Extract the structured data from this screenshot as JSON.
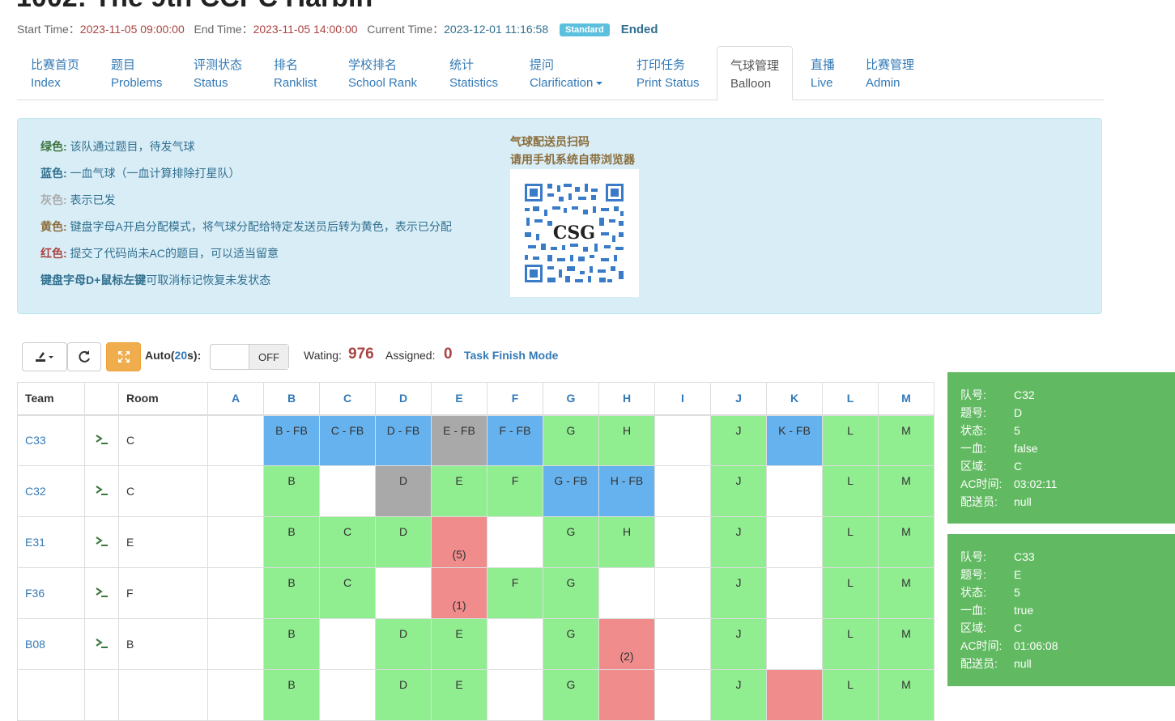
{
  "header": {
    "title": "1002: The 9th CCPC Harbin",
    "start_label": "Start Time：",
    "start_value": "2023-11-05 09:00:00",
    "end_label": "End Time：",
    "end_value": "2023-11-05 14:00:00",
    "current_label": "Current Time：",
    "current_value": "2023-12-01 11:16:58",
    "badge": "Standard",
    "status": "Ended"
  },
  "nav": [
    {
      "cn": "比赛首页",
      "en": "Index"
    },
    {
      "cn": "题目",
      "en": "Problems"
    },
    {
      "cn": "评测状态",
      "en": "Status"
    },
    {
      "cn": "排名",
      "en": "Ranklist"
    },
    {
      "cn": "学校排名",
      "en": "School Rank"
    },
    {
      "cn": "统计",
      "en": "Statistics"
    },
    {
      "cn": "提问",
      "en": "Clarification"
    },
    {
      "cn": "打印任务",
      "en": "Print Status"
    },
    {
      "cn": "气球管理",
      "en": "Balloon"
    },
    {
      "cn": "直播",
      "en": "Live"
    },
    {
      "cn": "比赛管理",
      "en": "Admin"
    }
  ],
  "legend": [
    {
      "key": "绿色:",
      "text": " 该队通过题目，待发气球",
      "color": "#3c763d"
    },
    {
      "key": "蓝色:",
      "text": " 一血气球（一血计算排除打星队）",
      "color": "#31708f"
    },
    {
      "key": "灰色:",
      "text": " 表示已发",
      "color": "#999999"
    },
    {
      "key": "黄色:",
      "text": " 键盘字母A开启分配模式，将气球分配给特定发送员后转为黄色，表示已分配",
      "color": "#8a6d3b"
    },
    {
      "key": "红色:",
      "text": " 提交了代码尚未AC的题目，可以适当留意",
      "color": "#a94442"
    },
    {
      "key": "键盘字母D+鼠标左键",
      "text": "可取消标记恢复未发状态",
      "color": "#31708f"
    }
  ],
  "qr": {
    "line1": "气球配送员扫码",
    "line2": "请用手机系统自带浏览器",
    "center_text": "CSG"
  },
  "toolbar": {
    "auto_label": "Auto(",
    "auto_num": "20",
    "auto_unit": "s):",
    "toggle_state": "OFF",
    "waiting_label": "Wating:",
    "waiting_value": "976",
    "assigned_label": "Assigned:",
    "assigned_value": "0",
    "mode_link": "Task Finish Mode"
  },
  "table": {
    "headers": [
      "Team",
      "",
      "Room",
      "A",
      "B",
      "C",
      "D",
      "E",
      "F",
      "G",
      "H",
      "I",
      "J",
      "K",
      "L",
      "M"
    ],
    "rows": [
      {
        "team": "C33",
        "room": "C",
        "cells": [
          null,
          {
            "t": "B - FB",
            "s": "blue"
          },
          {
            "t": "C - FB",
            "s": "blue"
          },
          {
            "t": "D - FB",
            "s": "blue"
          },
          {
            "t": "E - FB",
            "s": "gray"
          },
          {
            "t": "F - FB",
            "s": "blue"
          },
          {
            "t": "G",
            "s": "green"
          },
          {
            "t": "H",
            "s": "green"
          },
          null,
          {
            "t": "J",
            "s": "green"
          },
          {
            "t": "K - FB",
            "s": "blue"
          },
          {
            "t": "L",
            "s": "green"
          },
          {
            "t": "M",
            "s": "green"
          }
        ]
      },
      {
        "team": "C32",
        "room": "C",
        "cells": [
          null,
          {
            "t": "B",
            "s": "green"
          },
          null,
          {
            "t": "D",
            "s": "gray"
          },
          {
            "t": "E",
            "s": "green"
          },
          {
            "t": "F",
            "s": "green"
          },
          {
            "t": "G - FB",
            "s": "blue"
          },
          {
            "t": "H - FB",
            "s": "blue"
          },
          null,
          {
            "t": "J",
            "s": "green"
          },
          null,
          {
            "t": "L",
            "s": "green"
          },
          {
            "t": "M",
            "s": "green"
          }
        ]
      },
      {
        "team": "E31",
        "room": "E",
        "cells": [
          null,
          {
            "t": "B",
            "s": "green"
          },
          {
            "t": "C",
            "s": "green"
          },
          {
            "t": "D",
            "s": "green"
          },
          {
            "t": "",
            "p": "(5)",
            "s": "red"
          },
          null,
          {
            "t": "G",
            "s": "green"
          },
          {
            "t": "H",
            "s": "green"
          },
          null,
          {
            "t": "J",
            "s": "green"
          },
          null,
          {
            "t": "L",
            "s": "green"
          },
          {
            "t": "M",
            "s": "green"
          }
        ]
      },
      {
        "team": "F36",
        "room": "F",
        "cells": [
          null,
          {
            "t": "B",
            "s": "green"
          },
          {
            "t": "C",
            "s": "green"
          },
          null,
          {
            "t": "",
            "p": "(1)",
            "s": "red"
          },
          {
            "t": "F",
            "s": "green"
          },
          {
            "t": "G",
            "s": "green"
          },
          null,
          null,
          {
            "t": "J",
            "s": "green"
          },
          null,
          {
            "t": "L",
            "s": "green"
          },
          {
            "t": "M",
            "s": "green"
          }
        ]
      },
      {
        "team": "B08",
        "room": "B",
        "cells": [
          null,
          {
            "t": "B",
            "s": "green"
          },
          null,
          {
            "t": "D",
            "s": "green"
          },
          {
            "t": "E",
            "s": "green"
          },
          null,
          {
            "t": "G",
            "s": "green"
          },
          {
            "t": "",
            "p": "(2)",
            "s": "red"
          },
          null,
          {
            "t": "J",
            "s": "green"
          },
          null,
          {
            "t": "L",
            "s": "green"
          },
          {
            "t": "M",
            "s": "green"
          }
        ]
      },
      {
        "team": "",
        "room": "",
        "cells": [
          null,
          {
            "t": "B",
            "s": "green"
          },
          null,
          {
            "t": "D",
            "s": "green"
          },
          {
            "t": "E",
            "s": "green"
          },
          null,
          {
            "t": "G",
            "s": "green"
          },
          {
            "t": "",
            "s": "red"
          },
          null,
          {
            "t": "J",
            "s": "green"
          },
          {
            "t": "",
            "s": "red"
          },
          {
            "t": "L",
            "s": "green"
          },
          {
            "t": "M",
            "s": "green"
          }
        ]
      }
    ]
  },
  "popups": [
    {
      "rows": [
        {
          "k": "队号:",
          "v": "C32"
        },
        {
          "k": "题号:",
          "v": "D"
        },
        {
          "k": "状态:",
          "v": "5"
        },
        {
          "k": "一血:",
          "v": "false"
        },
        {
          "k": "区域:",
          "v": "C"
        },
        {
          "k": "AC时间:",
          "v": "03:02:11"
        },
        {
          "k": "配送员:",
          "v": "null"
        }
      ]
    },
    {
      "rows": [
        {
          "k": "队号:",
          "v": "C33"
        },
        {
          "k": "题号:",
          "v": "E"
        },
        {
          "k": "状态:",
          "v": "5"
        },
        {
          "k": "一血:",
          "v": "true"
        },
        {
          "k": "区域:",
          "v": "C"
        },
        {
          "k": "AC时间:",
          "v": "01:06:08"
        },
        {
          "k": "配送员:",
          "v": "null"
        }
      ]
    }
  ],
  "colors": {
    "green": "#90ee90",
    "blue": "#66b2ee",
    "gray": "#a9a9a9",
    "red": "#f08c8c",
    "popup": "#5cb85c"
  }
}
